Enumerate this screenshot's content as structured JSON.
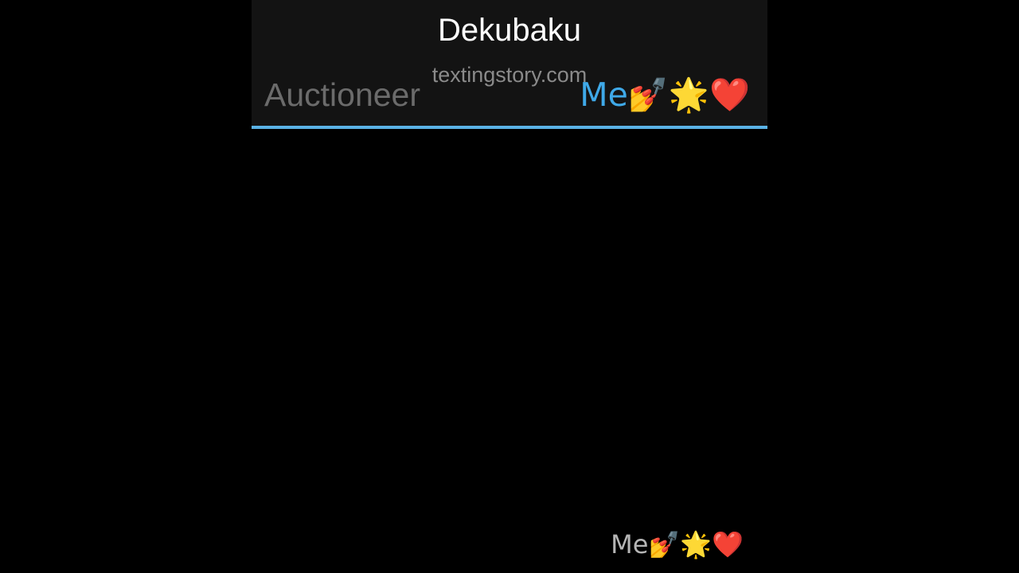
{
  "header": {
    "title": "Dekubaku",
    "watermark": "textingstory.com"
  },
  "tabs": [
    {
      "label": "Auctioneer",
      "active": false
    },
    {
      "label": "Me💅🌟❤️",
      "active": true
    }
  ],
  "chat": {
    "sender_label": "Me💅🌟❤️"
  },
  "colors": {
    "background": "#000000",
    "header_background": "#131313",
    "accent": "#5ab2e6",
    "active_tab_text": "#3fa9e8",
    "inactive_tab_text": "#6b6b6b"
  }
}
